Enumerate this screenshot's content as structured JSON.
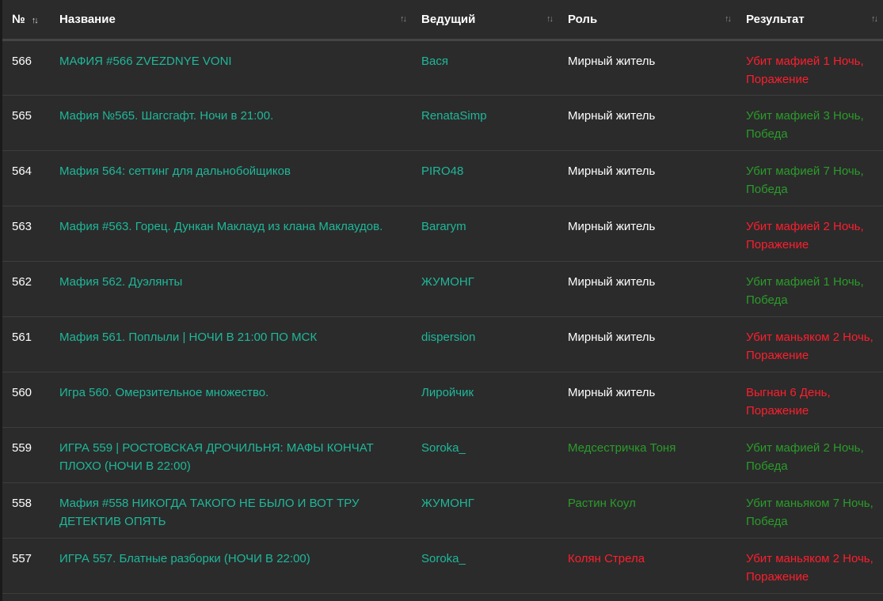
{
  "colors": {
    "background": "#2b2b2b",
    "link": "#1eb89a",
    "loss": "#ff1e2d",
    "win": "#2a9c2a",
    "text": "#ffffff"
  },
  "icons": {
    "sort": "sort-arrows-icon"
  },
  "headers": {
    "num": "№",
    "title": "Название",
    "host": "Ведущий",
    "role": "Роль",
    "result": "Результат",
    "sort_glyph": "↑↓"
  },
  "rows": [
    {
      "num": "566",
      "title": "МАФИЯ #566 ZVEZDNYE VONI",
      "host": "Вася",
      "role": "Мирный житель",
      "role_color": "neutral",
      "result_line1": "Убит мафией 1 Ночь,",
      "result_line2": "Поражение",
      "result_color": "loss"
    },
    {
      "num": "565",
      "title": "Мафия №565. Шагсгафт. Ночи в 21:00.",
      "host": "RenataSimp",
      "role": "Мирный житель",
      "role_color": "neutral",
      "result_line1": "Убит мафией 3 Ночь,",
      "result_line2": "Победа",
      "result_color": "win"
    },
    {
      "num": "564",
      "title": "Мафия 564: сеттинг для дальнобойщиков",
      "host": "PIRO48",
      "role": "Мирный житель",
      "role_color": "neutral",
      "result_line1": "Убит мафией 7 Ночь,",
      "result_line2": "Победа",
      "result_color": "win"
    },
    {
      "num": "563",
      "title": "Мафия #563. Горец. Дункан Маклауд из клана Маклаудов.",
      "host": "Bararym",
      "role": "Мирный житель",
      "role_color": "neutral",
      "result_line1": "Убит мафией 2 Ночь,",
      "result_line2": "Поражение",
      "result_color": "loss"
    },
    {
      "num": "562",
      "title": "Мафия 562. Дуэлянты",
      "host": "ЖУМОНГ",
      "role": "Мирный житель",
      "role_color": "neutral",
      "result_line1": "Убит мафией 1 Ночь,",
      "result_line2": "Победа",
      "result_color": "win"
    },
    {
      "num": "561",
      "title": "Мафия 561. Поплыли | НОЧИ В 21:00 ПО МСК",
      "host": "dispersion",
      "role": "Мирный житель",
      "role_color": "neutral",
      "result_line1": "Убит маньяком 2 Ночь,",
      "result_line2": "Поражение",
      "result_color": "loss"
    },
    {
      "num": "560",
      "title": "Игра 560. Омерзительное множество.",
      "host": "Лиройчик",
      "role": "Мирный житель",
      "role_color": "neutral",
      "result_line1": "Выгнан 6 День,",
      "result_line2": "Поражение",
      "result_color": "loss"
    },
    {
      "num": "559",
      "title": "ИГРА 559 | РОСТОВСКАЯ ДРОЧИЛЬНЯ: МАФЫ КОНЧАТ ПЛОХО (НОЧИ В 22:00)",
      "host": "Soroka_",
      "role": "Медсестричка Тоня",
      "role_color": "win",
      "result_line1": "Убит мафией 2 Ночь,",
      "result_line2": "Победа",
      "result_color": "win"
    },
    {
      "num": "558",
      "title": "Мафия #558 НИКОГДА ТАКОГО НЕ БЫЛО И ВОТ ТРУ ДЕТЕКТИВ ОПЯТЬ",
      "host": "ЖУМОНГ",
      "role": "Растин Коул",
      "role_color": "win",
      "result_line1": "Убит маньяком 7 Ночь,",
      "result_line2": "Победа",
      "result_color": "win"
    },
    {
      "num": "557",
      "title": "ИГРА 557. Блатные разборки (НОЧИ В 22:00)",
      "host": "Soroka_",
      "role": "Колян Стрела",
      "role_color": "loss",
      "result_line1": "Убит маньяком 2 Ночь,",
      "result_line2": "Поражение",
      "result_color": "loss"
    }
  ]
}
